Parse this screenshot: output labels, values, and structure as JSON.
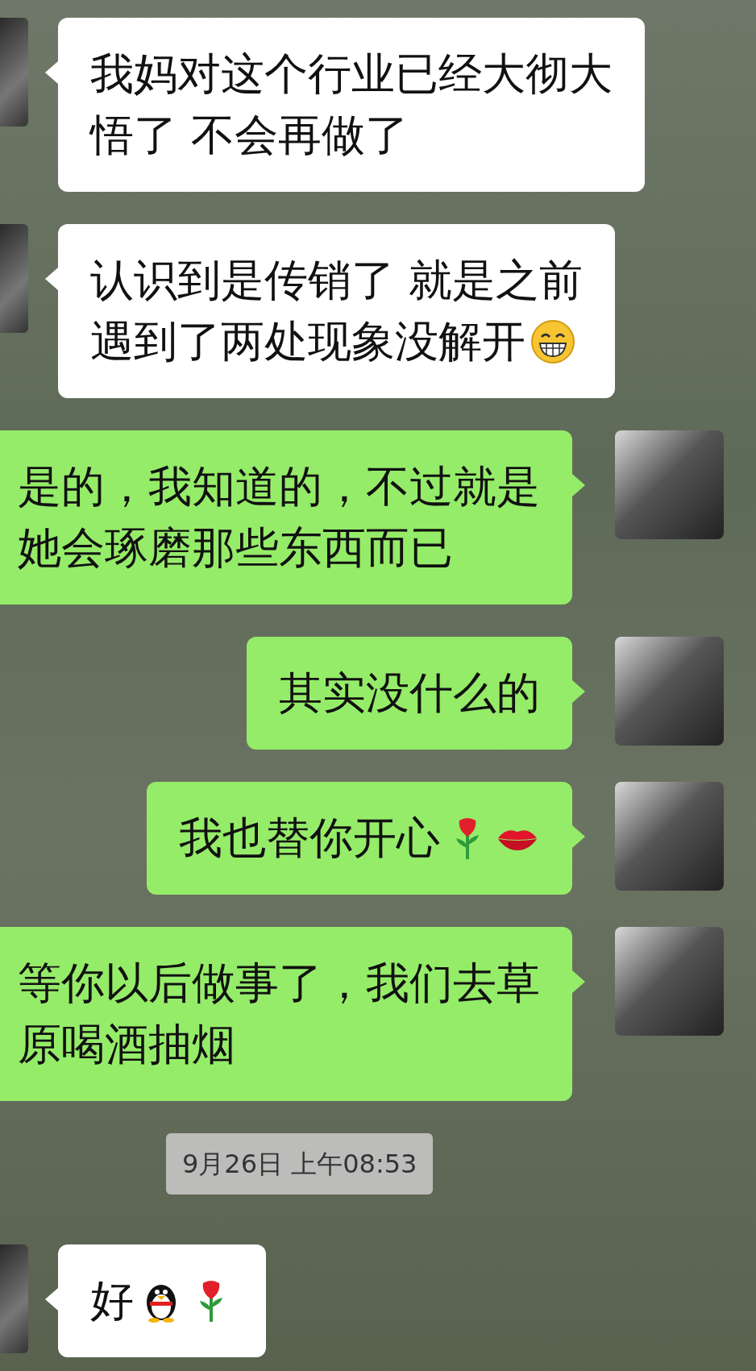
{
  "messages": [
    {
      "kind": "incoming",
      "lines": [
        [
          {
            "kind": "text",
            "text": "我妈对这个行业已经大彻大"
          }
        ],
        [
          {
            "kind": "text",
            "text": "悟了 不会再做了"
          }
        ]
      ]
    },
    {
      "kind": "incoming",
      "lines": [
        [
          {
            "kind": "text",
            "text": "认识到是传销了 就是之前"
          }
        ],
        [
          {
            "kind": "text",
            "text": "遇到了两处现象没解开"
          },
          {
            "kind": "grin"
          }
        ]
      ]
    },
    {
      "kind": "outgoing",
      "lines": [
        [
          {
            "kind": "text",
            "text": "是的，我知道的，不过就是"
          }
        ],
        [
          {
            "kind": "text",
            "text": "她会琢磨那些东西而已"
          }
        ]
      ]
    },
    {
      "kind": "outgoing",
      "lines": [
        [
          {
            "kind": "text",
            "text": "其实没什么的"
          }
        ]
      ]
    },
    {
      "kind": "outgoing",
      "lines": [
        [
          {
            "kind": "text",
            "text": "我也替你开心"
          },
          {
            "kind": "rose"
          },
          {
            "kind": "lips"
          }
        ]
      ]
    },
    {
      "kind": "outgoing",
      "lines": [
        [
          {
            "kind": "text",
            "text": "等你以后做事了，我们去草"
          }
        ],
        [
          {
            "kind": "text",
            "text": "原喝酒抽烟"
          }
        ]
      ]
    },
    {
      "kind": "time",
      "text": "9月26日 上午08:53"
    },
    {
      "kind": "incoming",
      "lines": [
        [
          {
            "kind": "text",
            "text": "好"
          },
          {
            "kind": "penguin"
          },
          {
            "kind": "rose"
          }
        ]
      ]
    }
  ]
}
